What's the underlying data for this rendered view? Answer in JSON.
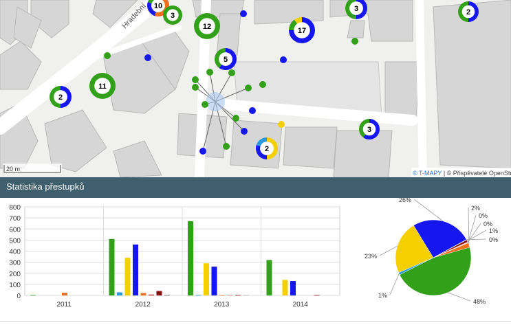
{
  "map": {
    "street_label": "Hradební",
    "scale_label": "20 m",
    "attribution_tmapy": "© T-MAPY",
    "attribution_sep": " | ",
    "attribution_osm": "© Přispěvatelé OpenStreetMap",
    "clusters": [
      {
        "label": "10"
      },
      {
        "label": "3"
      },
      {
        "label": "12"
      },
      {
        "label": "3"
      },
      {
        "label": "17"
      },
      {
        "label": "2"
      },
      {
        "label": "5"
      },
      {
        "label": "11"
      },
      {
        "label": "2"
      },
      {
        "label": "3"
      },
      {
        "label": "2"
      }
    ],
    "colors": {
      "green": "#33a01a",
      "blue": "#1616f0",
      "yellow": "#f5d000",
      "orange": "#f07020",
      "lightblue": "#2a9ae0"
    }
  },
  "section": {
    "title": "Statistika přestupků"
  },
  "chart_data": [
    {
      "type": "bar",
      "categories": [
        "2011",
        "2012",
        "2013",
        "2014"
      ],
      "yticks": [
        "0",
        "100",
        "200",
        "300",
        "400",
        "500",
        "600",
        "700",
        "800"
      ],
      "ylim": [
        0,
        800
      ],
      "grid": true,
      "series_colors": [
        "#33a01a",
        "#2a9ae0",
        "#f5d000",
        "#1616f0",
        "#f07020",
        "#c03020",
        "#8a1010",
        "#555555"
      ],
      "values": [
        [
          5,
          0,
          0,
          0,
          25,
          0,
          0,
          0
        ],
        [
          510,
          28,
          340,
          460,
          22,
          8,
          40,
          5
        ],
        [
          670,
          5,
          290,
          260,
          5,
          3,
          5,
          2
        ],
        [
          320,
          0,
          140,
          130,
          0,
          0,
          5,
          0
        ]
      ]
    },
    {
      "type": "pie",
      "slices": [
        {
          "value": 48,
          "label": "48%",
          "color": "#33a01a"
        },
        {
          "value": 1,
          "label": "1%",
          "color": "#2a9ae0"
        },
        {
          "value": 23,
          "label": "23%",
          "color": "#f5d000"
        },
        {
          "value": 26,
          "label": "26%",
          "color": "#1616f0"
        },
        {
          "value": 0,
          "label": "0%",
          "color": "#555555"
        },
        {
          "value": 1,
          "label": "1%",
          "color": "#8a1010"
        },
        {
          "value": 0,
          "label": "0%",
          "color": "#c03020"
        },
        {
          "value": 0,
          "label": "0%",
          "color": "#e0a040"
        },
        {
          "value": 2,
          "label": "2%",
          "color": "#f07020"
        }
      ]
    }
  ]
}
